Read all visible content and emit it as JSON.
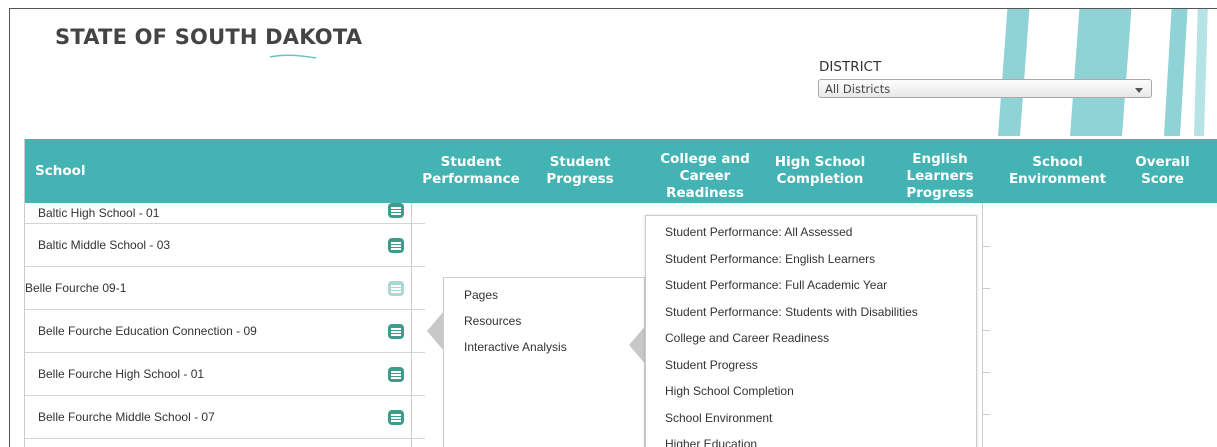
{
  "brand": "STATE OF SOUTH DAKOTA",
  "district": {
    "label": "DISTRICT",
    "selected": "All Districts"
  },
  "table": {
    "headers": {
      "school": "School",
      "columns": [
        [
          "Student",
          "Performance"
        ],
        [
          "Student",
          "Progress"
        ],
        [
          "College and",
          "Career",
          "Readiness"
        ],
        [
          "High School",
          "Completion"
        ],
        [
          "English",
          "Learners",
          "Progress"
        ],
        [
          "School",
          "Environment"
        ],
        [
          "Overall",
          "Score"
        ]
      ]
    },
    "rows": [
      "Baltic High School - 01",
      "Baltic Middle School - 03",
      "Belle Fourche 09-1",
      "Belle Fourche Education Connection - 09",
      "Belle Fourche High School - 01",
      "Belle Fourche Middle School - 07"
    ]
  },
  "menu": {
    "items": [
      "Pages",
      "Resources",
      "Interactive Analysis"
    ]
  },
  "submenu": {
    "items": [
      "Student Performance: All Assessed",
      "Student Performance: English Learners",
      "Student Performance: Full Academic Year",
      "Student Performance: Students with Disabilities",
      "College and Career Readiness",
      "Student Progress",
      "High School Completion",
      "School Environment",
      "Higher Education"
    ]
  },
  "colors": {
    "header_teal": "#44b3b4",
    "button_green": "#3f9c8c",
    "decor_teal": "#8fd3d6"
  },
  "icons": {
    "row_button": "list-icon",
    "select_caret": "chevron-down-icon"
  }
}
